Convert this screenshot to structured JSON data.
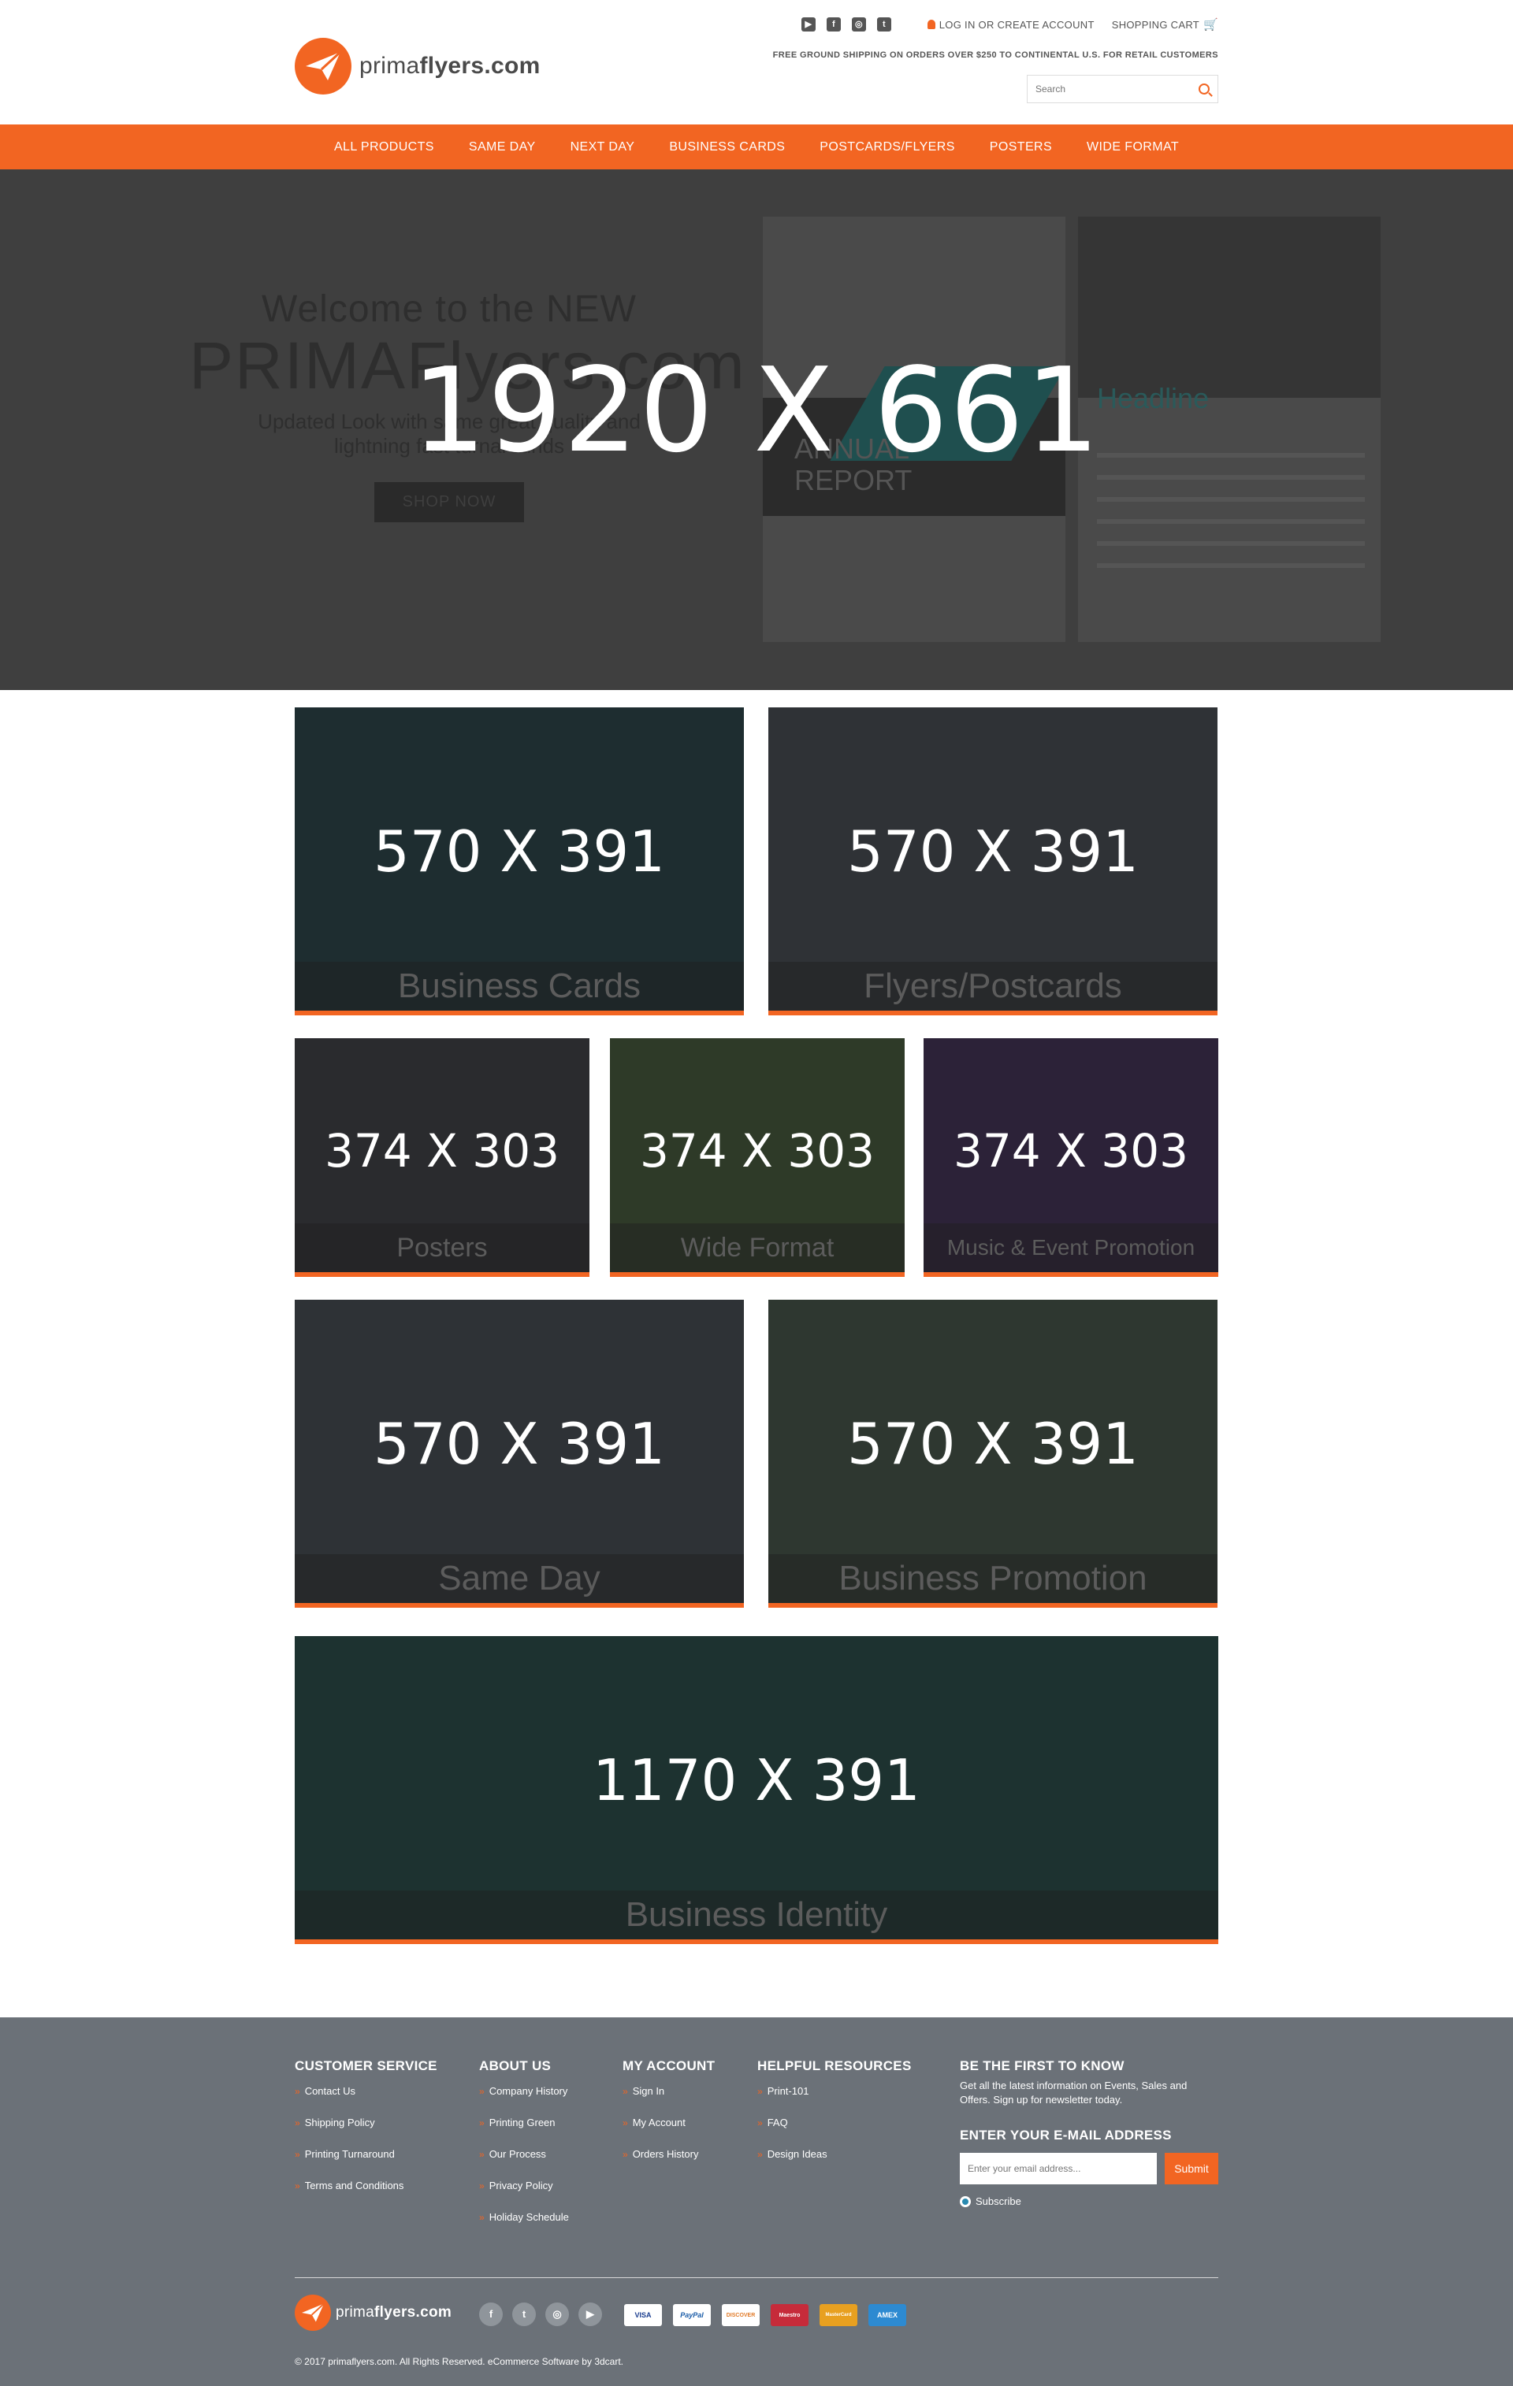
{
  "header": {
    "logo_text_light": "prima",
    "logo_text_bold": "flyers.com",
    "login_label": "LOG IN OR CREATE ACCOUNT",
    "cart_label": "SHOPPING CART",
    "shipping_note": "FREE GROUND SHIPPING ON ORDERS OVER $250 TO CONTINENTAL U.S. FOR RETAIL CUSTOMERS",
    "search_placeholder": "Search",
    "social_icons": [
      "youtube-icon",
      "facebook-icon",
      "instagram-icon",
      "twitter-icon"
    ]
  },
  "nav": {
    "items": [
      "ALL PRODUCTS",
      "SAME DAY",
      "NEXT DAY",
      "BUSINESS CARDS",
      "POSTCARDS/FLYERS",
      "POSTERS",
      "WIDE FORMAT"
    ]
  },
  "hero": {
    "welcome": "Welcome to the NEW",
    "brand": "PRIMAFlyers.com",
    "tagline_1": "Updated Look with same great quality and",
    "tagline_2": "lightning fast turnarounds",
    "shop_button": "SHOP NOW",
    "doc_title_1": "ANNUAL",
    "doc_title_2": "REPORT",
    "doc_headline": "Headline",
    "size_label": "1920 X 661"
  },
  "tiles": [
    {
      "caption": "Business Cards",
      "size": "570 X 391"
    },
    {
      "caption": "Flyers/Postcards",
      "size": "570 X 391"
    },
    {
      "caption": "Posters",
      "size": "374 X 303"
    },
    {
      "caption": "Wide Format",
      "size": "374 X 303"
    },
    {
      "caption": "Music & Event Promotion",
      "size": "374 X 303"
    },
    {
      "caption": "Same Day",
      "size": "570 X 391"
    },
    {
      "caption": "Business Promotion",
      "size": "570 X 391"
    },
    {
      "caption": "Business Identity",
      "size": "1170 X 391"
    }
  ],
  "tile_colors": [
    "#1e2d30",
    "#2f3236",
    "#2a2b2e",
    "#2e3a28",
    "#2c2238",
    "#2e3236",
    "#2e3730",
    "#1d3230"
  ],
  "footer": {
    "customer_service": {
      "title": "CUSTOMER SERVICE",
      "items": [
        "Contact Us",
        "Shipping Policy",
        "Printing Turnaround",
        "Terms and Conditions"
      ]
    },
    "about_us": {
      "title": "ABOUT US",
      "items": [
        "Company History",
        "Printing Green",
        "Our Process",
        "Privacy Policy",
        "Holiday Schedule"
      ]
    },
    "my_account": {
      "title": "MY ACCOUNT",
      "items": [
        "Sign In",
        "My Account",
        "Orders History"
      ]
    },
    "helpful_resources": {
      "title": "HELPFUL RESOURCES",
      "items": [
        "Print-101",
        "FAQ",
        "Design Ideas"
      ]
    },
    "newsletter": {
      "title": "BE THE FIRST TO KNOW",
      "text": "Get all the latest information on Events, Sales and Offers. Sign up for newsletter today.",
      "email_title": "ENTER YOUR E-MAIL ADDRESS",
      "email_placeholder": "Enter your email address...",
      "submit_label": "Submit",
      "subscribe_label": "Subscribe"
    },
    "logo_text_light": "prima",
    "logo_text_bold": "flyers.com",
    "social": [
      "f",
      "t",
      "◎",
      "▶"
    ],
    "payments": [
      "VISA",
      "PayPal",
      "DISCOVER",
      "Maestro",
      "MasterCard",
      "AMEX"
    ],
    "copyright": "© 2017 primaflyers.com. All Rights Reserved. eCommerce Software by 3dcart."
  },
  "colors": {
    "accent": "#f26522",
    "footer_bg": "#6b7178",
    "hero_bg": "#3f3f3f"
  }
}
